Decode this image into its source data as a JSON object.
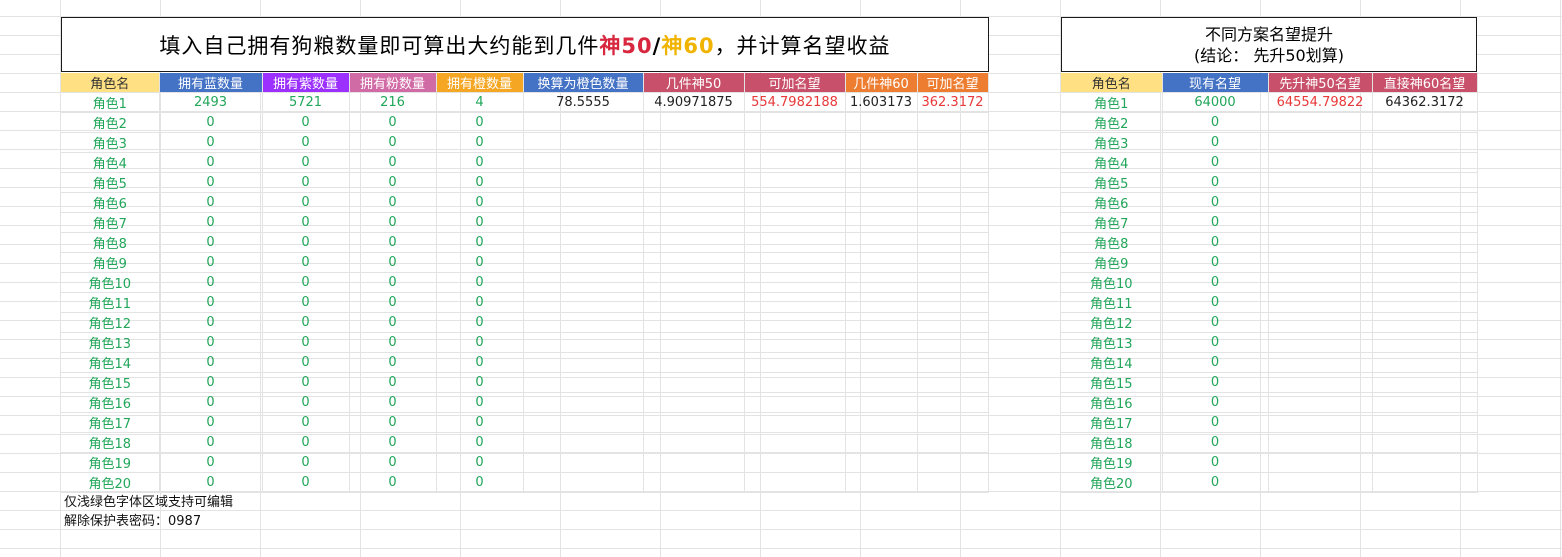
{
  "left_title": {
    "prefix": "填入自己拥有狗粮数量即可算出大约能到几件",
    "shen50": "神50",
    "slash": "/",
    "shen60": "神60",
    "suffix": "，并计算名望收益"
  },
  "right_title": {
    "line1": "不同方案名望提升",
    "line2": "(结论：  先升50划算)"
  },
  "left_table": {
    "headers": [
      "角色名",
      "拥有蓝数量",
      "拥有紫数量",
      "拥有粉数量",
      "拥有橙数量",
      "换算为橙色数量",
      "几件神50",
      "可加名望",
      "几件神60",
      "可加名望"
    ],
    "header_colors": [
      "#ffe083",
      "#4472c4",
      "#9b30ff",
      "#d16ba5",
      "#f5a623",
      "#4472c4",
      "#c9506a",
      "#c9506a",
      "#ed7d31",
      "#ed7d31"
    ],
    "rows": [
      [
        "角色1",
        "2493",
        "5721",
        "216",
        "4",
        "78.5555",
        "4.90971875",
        "554.7982188",
        "1.603173",
        "362.3172"
      ],
      [
        "角色2",
        "0",
        "0",
        "0",
        "0",
        "",
        "",
        "",
        "",
        ""
      ],
      [
        "角色3",
        "0",
        "0",
        "0",
        "0",
        "",
        "",
        "",
        "",
        ""
      ],
      [
        "角色4",
        "0",
        "0",
        "0",
        "0",
        "",
        "",
        "",
        "",
        ""
      ],
      [
        "角色5",
        "0",
        "0",
        "0",
        "0",
        "",
        "",
        "",
        "",
        ""
      ],
      [
        "角色6",
        "0",
        "0",
        "0",
        "0",
        "",
        "",
        "",
        "",
        ""
      ],
      [
        "角色7",
        "0",
        "0",
        "0",
        "0",
        "",
        "",
        "",
        "",
        ""
      ],
      [
        "角色8",
        "0",
        "0",
        "0",
        "0",
        "",
        "",
        "",
        "",
        ""
      ],
      [
        "角色9",
        "0",
        "0",
        "0",
        "0",
        "",
        "",
        "",
        "",
        ""
      ],
      [
        "角色10",
        "0",
        "0",
        "0",
        "0",
        "",
        "",
        "",
        "",
        ""
      ],
      [
        "角色11",
        "0",
        "0",
        "0",
        "0",
        "",
        "",
        "",
        "",
        ""
      ],
      [
        "角色12",
        "0",
        "0",
        "0",
        "0",
        "",
        "",
        "",
        "",
        ""
      ],
      [
        "角色13",
        "0",
        "0",
        "0",
        "0",
        "",
        "",
        "",
        "",
        ""
      ],
      [
        "角色14",
        "0",
        "0",
        "0",
        "0",
        "",
        "",
        "",
        "",
        ""
      ],
      [
        "角色15",
        "0",
        "0",
        "0",
        "0",
        "",
        "",
        "",
        "",
        ""
      ],
      [
        "角色16",
        "0",
        "0",
        "0",
        "0",
        "",
        "",
        "",
        "",
        ""
      ],
      [
        "角色17",
        "0",
        "0",
        "0",
        "0",
        "",
        "",
        "",
        "",
        ""
      ],
      [
        "角色18",
        "0",
        "0",
        "0",
        "0",
        "",
        "",
        "",
        "",
        ""
      ],
      [
        "角色19",
        "0",
        "0",
        "0",
        "0",
        "",
        "",
        "",
        "",
        ""
      ],
      [
        "角色20",
        "0",
        "0",
        "0",
        "0",
        "",
        "",
        "",
        "",
        ""
      ]
    ]
  },
  "right_table": {
    "headers": [
      "角色名",
      "现有名望",
      "先升神50名望",
      "直接神60名望"
    ],
    "header_colors": [
      "#ffe083",
      "#4472c4",
      "#c9506a",
      "#c9506a"
    ],
    "rows": [
      [
        "角色1",
        "64000",
        "64554.79822",
        "64362.3172"
      ],
      [
        "角色2",
        "0",
        "",
        ""
      ],
      [
        "角色3",
        "0",
        "",
        ""
      ],
      [
        "角色4",
        "0",
        "",
        ""
      ],
      [
        "角色5",
        "0",
        "",
        ""
      ],
      [
        "角色6",
        "0",
        "",
        ""
      ],
      [
        "角色7",
        "0",
        "",
        ""
      ],
      [
        "角色8",
        "0",
        "",
        ""
      ],
      [
        "角色9",
        "0",
        "",
        ""
      ],
      [
        "角色10",
        "0",
        "",
        ""
      ],
      [
        "角色11",
        "0",
        "",
        ""
      ],
      [
        "角色12",
        "0",
        "",
        ""
      ],
      [
        "角色13",
        "0",
        "",
        ""
      ],
      [
        "角色14",
        "0",
        "",
        ""
      ],
      [
        "角色15",
        "0",
        "",
        ""
      ],
      [
        "角色16",
        "0",
        "",
        ""
      ],
      [
        "角色17",
        "0",
        "",
        ""
      ],
      [
        "角色18",
        "0",
        "",
        ""
      ],
      [
        "角色19",
        "0",
        "",
        ""
      ],
      [
        "角色20",
        "0",
        "",
        ""
      ]
    ]
  },
  "notes": {
    "editable": "仅浅绿色字体区域支持可编辑",
    "password": "解除保护表密码：0987"
  },
  "colors": {
    "green_text": "#21a65a",
    "red_text": "#e8393a",
    "shen50": "#d7263d",
    "shen60": "#f0b400"
  }
}
